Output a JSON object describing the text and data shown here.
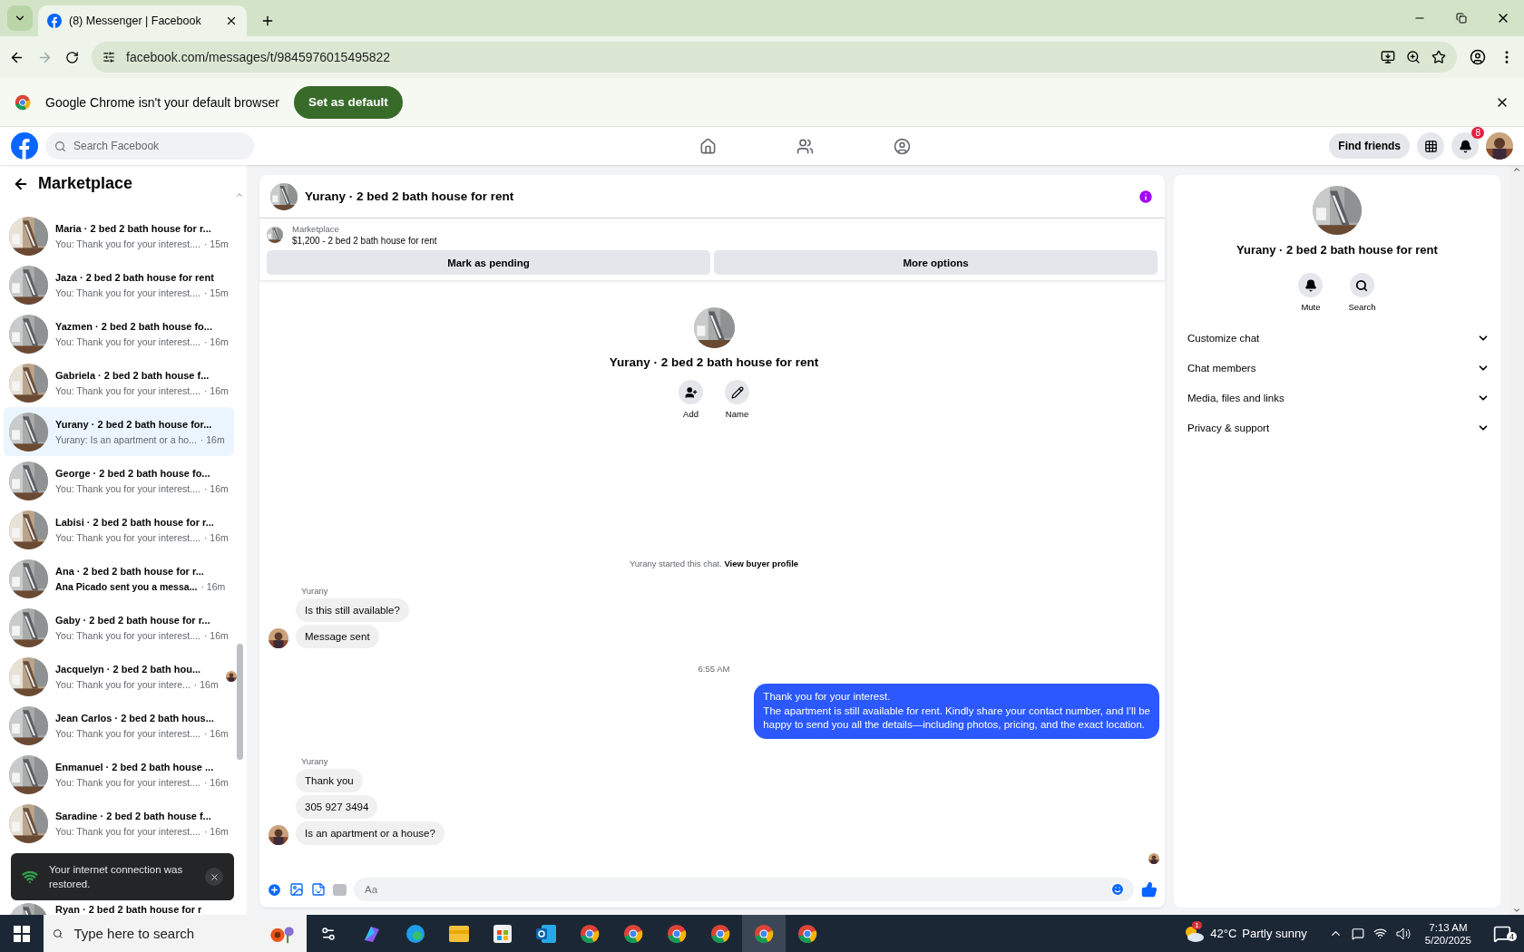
{
  "browser": {
    "tab_title": "(8) Messenger | Facebook",
    "url": "facebook.com/messages/t/9845976015495822",
    "infobar_text": "Google Chrome isn't your default browser",
    "infobar_button": "Set as default"
  },
  "header": {
    "search_placeholder": "Search Facebook",
    "find_friends": "Find friends",
    "notification_count": "8"
  },
  "sidebar": {
    "title": "Marketplace",
    "conversations": [
      {
        "name": "Maria · 2 bed 2 bath house for r...",
        "preview": "You: Thank you for your interest....",
        "time": "· 15m",
        "selected": false,
        "unread": false,
        "seen": false
      },
      {
        "name": "Jaza · 2 bed 2 bath house for rent",
        "preview": "You: Thank you for your interest....",
        "time": "· 15m",
        "selected": false,
        "unread": false,
        "seen": false
      },
      {
        "name": "Yazmen · 2 bed 2 bath house fo...",
        "preview": "You: Thank you for your interest....",
        "time": "· 16m",
        "selected": false,
        "unread": false,
        "seen": false
      },
      {
        "name": "Gabriela · 2 bed 2 bath house f...",
        "preview": "You: Thank you for your interest....",
        "time": "· 16m",
        "selected": false,
        "unread": false,
        "seen": false
      },
      {
        "name": "Yurany · 2 bed 2 bath house for...",
        "preview": "Yurany: Is an apartment or a ho...",
        "time": "· 16m",
        "selected": true,
        "unread": false,
        "seen": false
      },
      {
        "name": "George · 2 bed 2 bath house fo...",
        "preview": "You: Thank you for your interest....",
        "time": "· 16m",
        "selected": false,
        "unread": false,
        "seen": false
      },
      {
        "name": "Labisi · 2 bed 2 bath house for r...",
        "preview": "You: Thank you for your interest....",
        "time": "· 16m",
        "selected": false,
        "unread": false,
        "seen": false
      },
      {
        "name": "Ana · 2 bed 2 bath house for r...",
        "preview": "Ana Picado sent you a messa...",
        "time": "· 16m",
        "selected": false,
        "unread": true,
        "seen": false
      },
      {
        "name": "Gaby · 2 bed 2 bath house for r...",
        "preview": "You: Thank you for your interest....",
        "time": "· 16m",
        "selected": false,
        "unread": false,
        "seen": false
      },
      {
        "name": "Jacquelyn · 2 bed 2 bath hou...",
        "preview": "You: Thank you for your intere...",
        "time": "· 16m",
        "selected": false,
        "unread": false,
        "seen": true
      },
      {
        "name": "Jean Carlos · 2 bed 2 bath hous...",
        "preview": "You: Thank you for your interest....",
        "time": "· 16m",
        "selected": false,
        "unread": false,
        "seen": false
      },
      {
        "name": "Enmanuel · 2 bed 2 bath house ...",
        "preview": "You: Thank you for your interest....",
        "time": "· 16m",
        "selected": false,
        "unread": false,
        "seen": false
      },
      {
        "name": "Saradine · 2 bed 2 bath house f...",
        "preview": "You: Thank you for your interest....",
        "time": "· 16m",
        "selected": false,
        "unread": false,
        "seen": false
      }
    ],
    "partial_row": "Ryan · 2 bed 2 bath house for r"
  },
  "toast": {
    "text": "Your internet connection was restored."
  },
  "chat": {
    "title": "Yurany · 2 bed 2 bath house for rent",
    "listing_source": "Marketplace",
    "listing_title": "$1,200 - 2 bed 2 bath house for rent",
    "buttons": [
      "Mark as pending",
      "More options"
    ],
    "intro": {
      "name": "Yurany · 2 bed 2 bath house for rent",
      "actions": [
        {
          "kind": "add",
          "label": "Add"
        },
        {
          "kind": "name",
          "label": "Name"
        }
      ]
    },
    "messages": [
      {
        "kind": "system",
        "text": "Yurany started this chat.",
        "link": "View buyer profile"
      },
      {
        "kind": "sender",
        "text": "Yurany"
      },
      {
        "kind": "incoming",
        "text": "Is this still available?",
        "avatar": false
      },
      {
        "kind": "incoming",
        "text": "Message sent",
        "avatar": true
      },
      {
        "kind": "timestamp",
        "text": "6:55 AM"
      },
      {
        "kind": "outgoing",
        "text": "Thank you for your interest.\nThe apartment is still available for rent. Kindly share your contact number, and I'll be\nhappy to send you all the details—including photos, pricing, and the exact location."
      },
      {
        "kind": "sender",
        "text": "Yurany"
      },
      {
        "kind": "incoming",
        "text": "Thank you",
        "avatar": false
      },
      {
        "kind": "incoming",
        "text": "305 927 3494",
        "avatar": false
      },
      {
        "kind": "incoming",
        "text": "Is an apartment or a house?",
        "avatar": true
      }
    ],
    "composer_placeholder": "Aa"
  },
  "details": {
    "name": "Yurany · 2 bed 2 bath house for rent",
    "actions": [
      {
        "kind": "mute",
        "label": "Mute"
      },
      {
        "kind": "search",
        "label": "Search"
      }
    ],
    "sections": [
      {
        "label": "Customize chat",
        "expanded": false
      },
      {
        "label": "Chat members",
        "expanded": false
      },
      {
        "label": "Media, files and links",
        "expanded": false
      },
      {
        "label": "Privacy & support",
        "expanded": false
      }
    ]
  },
  "taskbar": {
    "search_placeholder": "Type here to search",
    "weather_badge": "1",
    "temperature": "42°C",
    "weather": "Partly sunny",
    "time": "7:13 AM",
    "date": "5/20/2025",
    "notification_count": "4"
  }
}
